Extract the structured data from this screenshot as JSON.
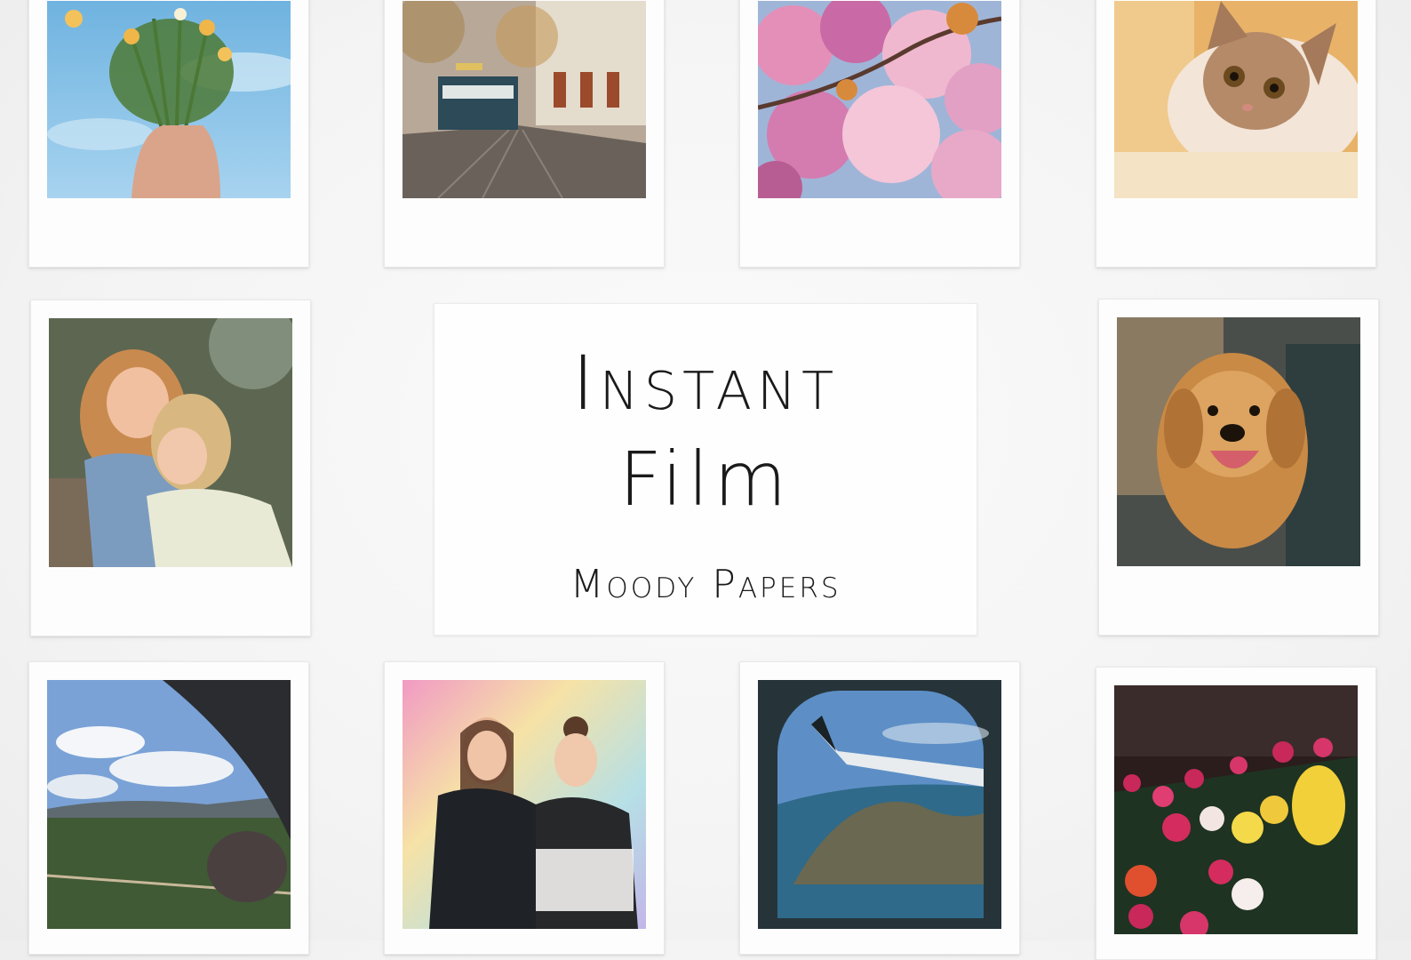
{
  "title_card": {
    "line1": "Instant",
    "line2": "Film",
    "brand": "Moody Papers"
  },
  "photos": [
    {
      "subject": "flower-bouquet"
    },
    {
      "subject": "tram-street"
    },
    {
      "subject": "cherry-blossoms"
    },
    {
      "subject": "kitten"
    },
    {
      "subject": "hugging-girls"
    },
    {
      "subject": "golden-retriever"
    },
    {
      "subject": "car-window-field"
    },
    {
      "subject": "two-women-laughing"
    },
    {
      "subject": "airplane-window"
    },
    {
      "subject": "tulips"
    }
  ],
  "colors": {
    "background": "#f4f4f4",
    "frame": "#fdfdfd",
    "ink": "#1a1a1a"
  }
}
